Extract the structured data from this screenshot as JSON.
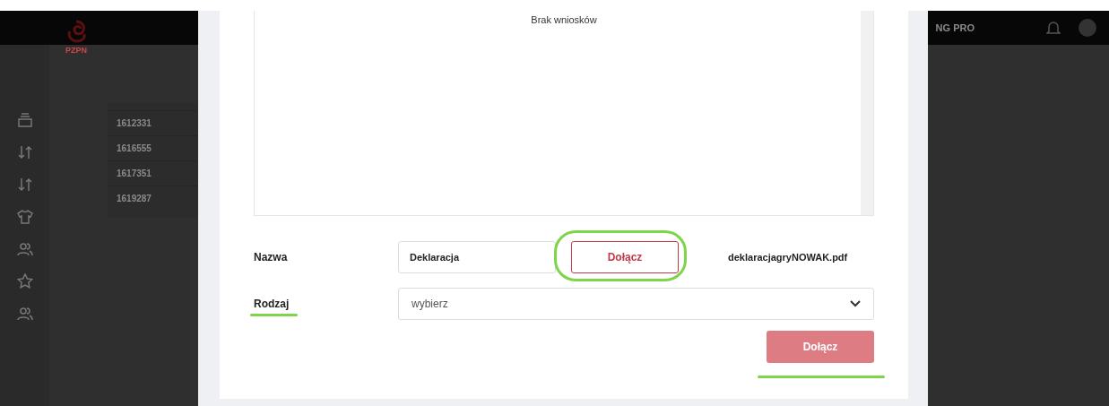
{
  "app": {
    "logo_text": "PZPN",
    "header_text": "NG PRO",
    "table_rows": [
      "1612331",
      "1616555",
      "1617351",
      "1619287"
    ]
  },
  "modal": {
    "list_empty_text": "Brak wniosków",
    "name_label": "Nazwa",
    "name_value": "Deklaracja",
    "attach_button": "Dołącz",
    "file_name": "deklaracjagryNOWAK.pdf",
    "type_label": "Rodzaj",
    "type_placeholder": "wybierz",
    "submit_button": "Dołącz",
    "submit_disabled": true
  }
}
